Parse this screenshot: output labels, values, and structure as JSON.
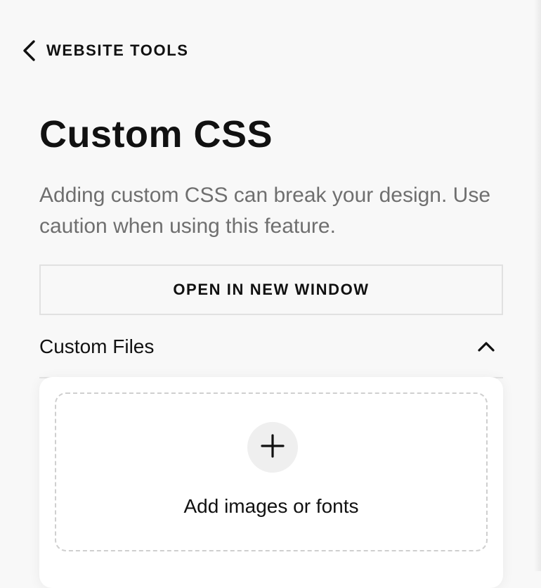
{
  "nav": {
    "back_label": "WEBSITE TOOLS",
    "back_icon": "chevron-left-icon"
  },
  "page": {
    "title": "Custom CSS",
    "description": "Adding custom CSS can break your design. Use caution when using this feature."
  },
  "actions": {
    "open_window_label": "OPEN IN NEW WINDOW"
  },
  "custom_files": {
    "title": "Custom Files",
    "expanded": true,
    "toggle_icon": "chevron-up-icon",
    "add_icon": "plus-icon",
    "add_label": "Add images or fonts"
  },
  "colors": {
    "background": "#f8f8f8",
    "text": "#111111",
    "muted_text": "#6f6f6f",
    "border": "#e1e1e1",
    "card": "#ffffff",
    "icon_circle": "#efefef"
  }
}
